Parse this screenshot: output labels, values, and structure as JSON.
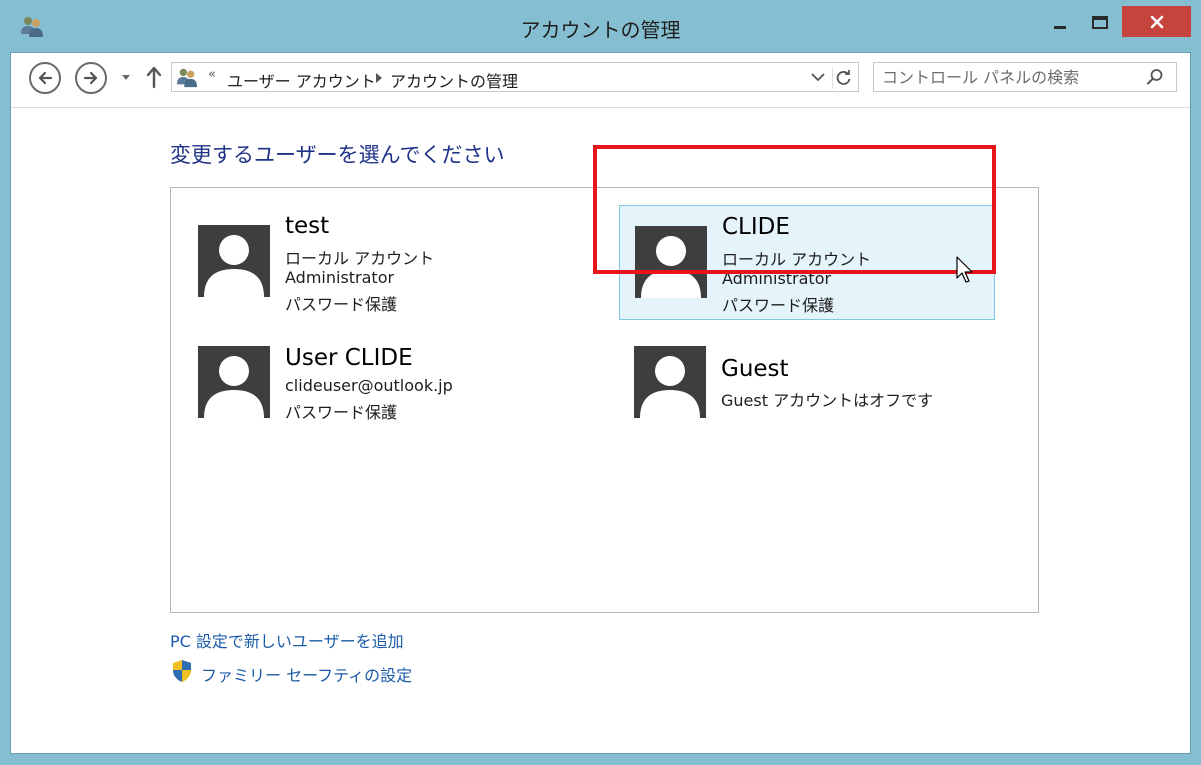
{
  "window": {
    "title": "アカウントの管理"
  },
  "address": {
    "chevron": "«",
    "crumbs": [
      "ユーザー アカウント",
      "アカウントの管理"
    ]
  },
  "search": {
    "placeholder": "コントロール パネルの検索"
  },
  "main": {
    "heading": "変更するユーザーを選んでください",
    "users": [
      {
        "name": "test",
        "lines": [
          "ローカル アカウント",
          "Administrator",
          "パスワード保護"
        ],
        "selected": false
      },
      {
        "name": "CLIDE",
        "lines": [
          "ローカル アカウント",
          "Administrator",
          "パスワード保護"
        ],
        "selected": true
      },
      {
        "name": "User CLIDE",
        "lines": [
          "clideuser@outlook.jp",
          "パスワード保護"
        ],
        "selected": false
      },
      {
        "name": "Guest",
        "lines": [
          "Guest アカウントはオフです"
        ],
        "selected": false
      }
    ],
    "links": {
      "add_user": "PC 設定で新しいユーザーを追加",
      "family_safety": "ファミリー セーフティの設定"
    }
  },
  "colors": {
    "window_frame": "#85bdd1",
    "close_button": "#c7433d",
    "heading": "#1e3287",
    "link": "#1c5ba8",
    "selected_tile_bg": "#e5f3fb",
    "selected_tile_border": "#7ec9e3",
    "highlight_box": "#e8141c",
    "avatar_bg": "#3e3e3e"
  },
  "icons": [
    "users-icon",
    "minimize-icon",
    "maximize-icon",
    "close-icon",
    "back-arrow-icon",
    "forward-arrow-icon",
    "dropdown-icon",
    "up-arrow-icon",
    "refresh-icon",
    "search-icon",
    "user-avatar-icon",
    "shield-icon",
    "mouse-cursor-icon"
  ]
}
